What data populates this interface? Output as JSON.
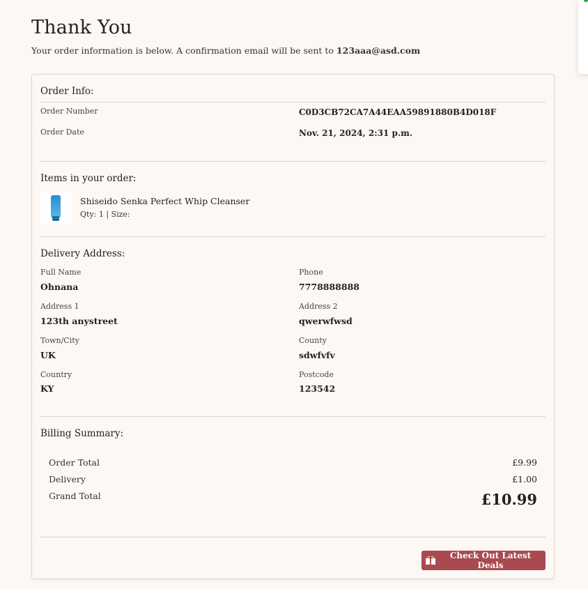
{
  "header": {
    "title": "Thank You",
    "subtitle_text": "Your order information is below. A confirmation email will be sent to ",
    "email": "123aaa@asd.com"
  },
  "order_info": {
    "heading": "Order Info:",
    "number_label": "Order Number",
    "number_value": "C0D3CB72CA7A44EAA59891880B4D018F",
    "date_label": "Order Date",
    "date_value": "Nov. 21, 2024, 2:31 p.m."
  },
  "items": {
    "heading": "Items in your order:",
    "list": [
      {
        "name": "Shiseido Senka Perfect Whip Cleanser",
        "meta": "Qty: 1 | Size:"
      }
    ]
  },
  "delivery": {
    "heading": "Delivery Address:",
    "full_name_label": "Full Name",
    "full_name": "Ohnana",
    "phone_label": "Phone",
    "phone": "7778888888",
    "address1_label": "Address 1",
    "address1": "123th anystreet",
    "address2_label": "Address 2",
    "address2": "qwerwfwsd",
    "town_label": "Town/City",
    "town": "UK",
    "county_label": "County",
    "county": "sdwfvfv",
    "country_label": "Country",
    "country": "KY",
    "postcode_label": "Postcode",
    "postcode": "123542"
  },
  "billing": {
    "heading": "Billing Summary:",
    "order_total_label": "Order Total",
    "order_total": "£9.99",
    "delivery_label": "Delivery",
    "delivery": "£1.00",
    "grand_total_label": "Grand Total",
    "grand_total": "£10.99"
  },
  "cta": {
    "label": "Check Out Latest Deals",
    "icon": "gift-icon",
    "color": "#a84a50"
  }
}
